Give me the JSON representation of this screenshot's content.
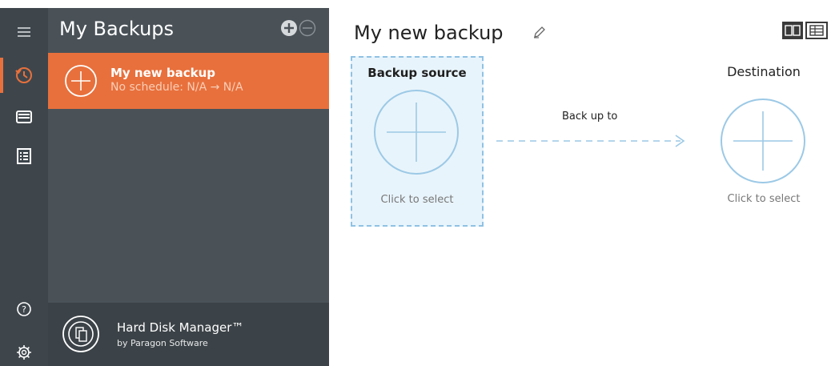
{
  "sidebar": {
    "title": "My Backups",
    "icons": [
      "menu-icon",
      "history-icon",
      "drive-icon",
      "log-icon",
      "help-icon",
      "settings-icon"
    ],
    "backups": [
      {
        "name": "My new backup",
        "schedule": "No schedule: N/A → N/A",
        "selected": true
      }
    ],
    "brand": {
      "name": "Hard Disk Manager™",
      "by": "by Paragon Software"
    }
  },
  "main": {
    "title": "My new backup",
    "source": {
      "title": "Backup source",
      "caption": "Click to select"
    },
    "connector_label": "Back up to",
    "destination": {
      "title": "Destination",
      "caption": "Click to select"
    }
  },
  "colors": {
    "accent": "#e8703c",
    "rail": "#3e464c",
    "panel": "#4a5258",
    "circle": "#9cc9e6"
  }
}
